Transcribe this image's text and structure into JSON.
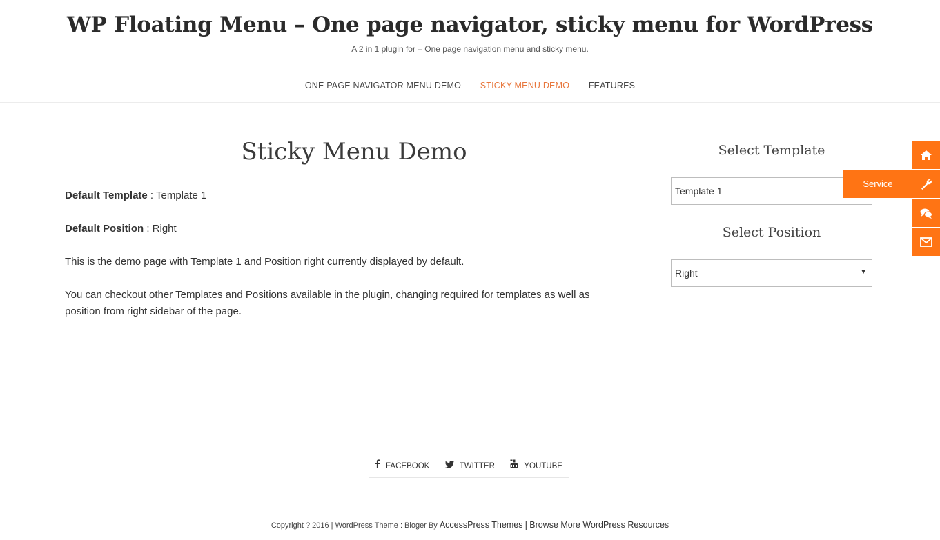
{
  "header": {
    "title": "WP Floating Menu – One page navigator, sticky menu for WordPress",
    "description": "A 2 in 1 plugin for – One page navigation menu and sticky menu."
  },
  "nav": {
    "items": [
      {
        "label": "ONE PAGE NAVIGATOR MENU DEMO"
      },
      {
        "label": "STICKY MENU DEMO",
        "active": true
      },
      {
        "label": "FEATURES"
      }
    ]
  },
  "content": {
    "title": "Sticky Menu Demo",
    "default_template_label": "Default Template",
    "default_template_value": " : Template 1",
    "default_position_label": "Default Position",
    "default_position_value": " : Right",
    "para1": "This is the demo page with Template 1 and Position right currently displayed by default.",
    "para2": "You can checkout other Templates and Positions available in the plugin, changing required for templates as well as position from right sidebar of the page."
  },
  "sidebar": {
    "template_title": "Select Template",
    "template_value": "Template 1",
    "position_title": "Select Position",
    "position_value": "Right"
  },
  "floating_menu": {
    "accent_color": "#ff7414",
    "items": [
      {
        "icon": "home-icon"
      },
      {
        "icon": "wrench-icon",
        "label": "Service"
      },
      {
        "icon": "comments-icon"
      },
      {
        "icon": "envelope-icon"
      }
    ]
  },
  "social": {
    "facebook": "FACEBOOK",
    "twitter": "TWITTER",
    "youtube": "YOUTUBE"
  },
  "footer": {
    "copyright": "Copyright ? 2016 | WordPress Theme : Bloger By ",
    "theme_link": "AccessPress Themes",
    "separator": "|",
    "resources_link": "Browse More WordPress Resources"
  },
  "colors": {
    "accent": "#e8773d",
    "float_bg": "#ff7414"
  }
}
